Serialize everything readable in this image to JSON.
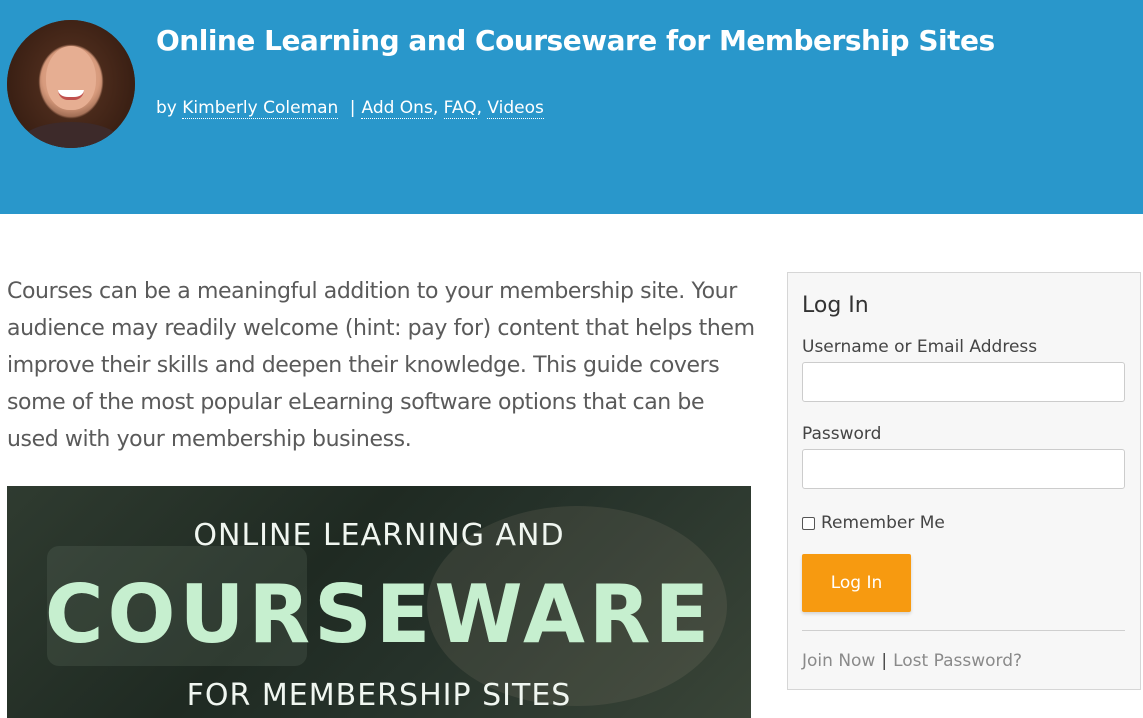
{
  "header": {
    "title": "Online Learning and Courseware for Membership Sites",
    "by_prefix": "by",
    "author": "Kimberly Coleman",
    "separator": "|",
    "categories": [
      "Add Ons",
      "FAQ",
      "Videos"
    ],
    "category_separator": ",",
    "background_color": "#2997cb"
  },
  "article": {
    "intro": "Courses can be a meaningful addition to your membership site. Your audience may readily welcome (hint: pay for) content that helps them improve their skills and deepen their knowledge. This guide covers some of the most popular eLearning software options that can be used with your membership business.",
    "feature_image": {
      "line1": "ONLINE LEARNING AND",
      "line2": "COURSEWARE",
      "line3": "FOR MEMBERSHIP SITES"
    }
  },
  "login": {
    "heading": "Log In",
    "username_label": "Username or Email Address",
    "username_value": "",
    "password_label": "Password",
    "password_value": "",
    "remember_label": "Remember Me",
    "remember_checked": false,
    "submit_label": "Log In",
    "submit_color": "#f79a10",
    "join_link": "Join Now",
    "links_separator": "|",
    "lost_password_link": "Lost Password?"
  }
}
